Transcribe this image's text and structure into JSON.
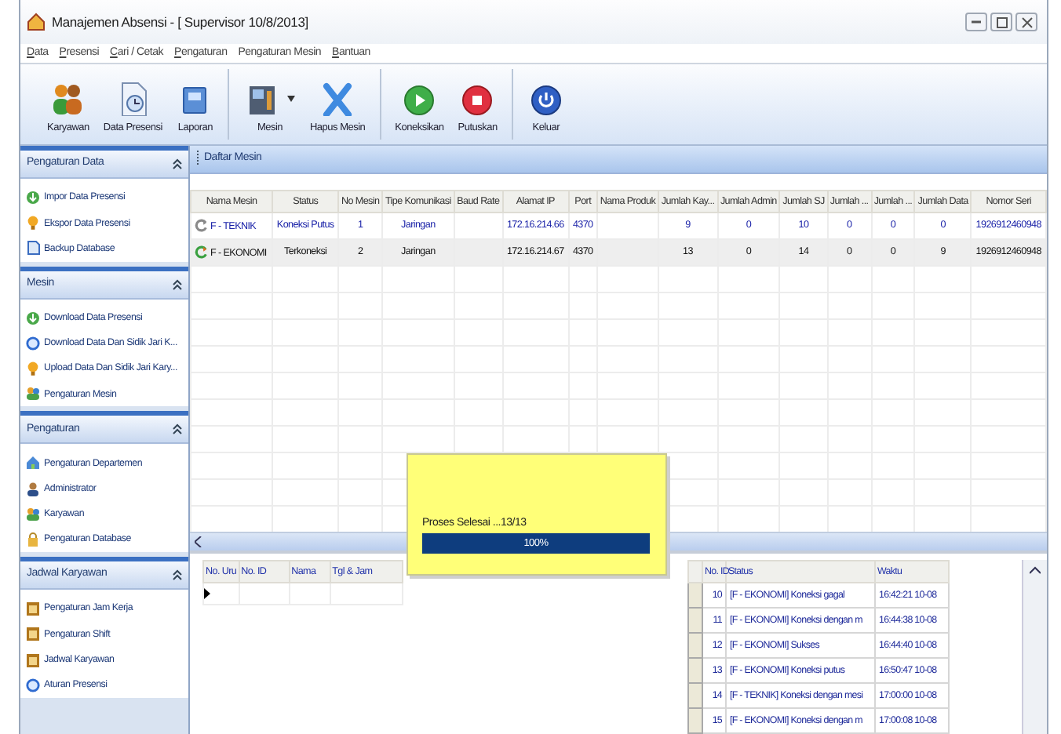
{
  "window": {
    "title": "Manajemen Absensi - [ Supervisor 10/8/2013]"
  },
  "menu": [
    {
      "label": "Data",
      "underline_first": true
    },
    {
      "label": "Presensi",
      "underline_first": true
    },
    {
      "label": "Cari / Cetak",
      "underline_first": true
    },
    {
      "label": "Pengaturan",
      "underline_first": true
    },
    {
      "label": "Pengaturan Mesin",
      "underline_first": false
    },
    {
      "label": "Bantuan",
      "underline_first": true
    }
  ],
  "toolbar": [
    [
      {
        "label": "Karyawan",
        "kind": "people",
        "dropdown": false
      },
      {
        "label": "Data Presensi",
        "kind": "document",
        "dropdown": false
      },
      {
        "label": "Laporan",
        "kind": "folder",
        "dropdown": false
      }
    ],
    [
      {
        "label": "Mesin",
        "kind": "machine",
        "dropdown": true
      },
      {
        "label": "Hapus Mesin",
        "kind": "xmark",
        "dropdown": false
      }
    ],
    [
      {
        "label": "Koneksikan",
        "kind": "play",
        "dropdown": false
      },
      {
        "label": "Putuskan",
        "kind": "stop",
        "dropdown": false
      }
    ],
    [
      {
        "label": "Keluar",
        "kind": "power",
        "dropdown": false
      }
    ]
  ],
  "sidebar": [
    {
      "title": "Pengaturan Data",
      "expanded": true,
      "items": [
        {
          "label": "Impor Data Presensi",
          "kind": "arrow"
        },
        {
          "label": "Ekspor Data Presensi",
          "kind": "bulb"
        },
        {
          "label": "Backup Database",
          "kind": "doc"
        }
      ]
    },
    {
      "title": "Mesin",
      "expanded": true,
      "items": [
        {
          "label": "Download Data Presensi",
          "kind": "arrow"
        },
        {
          "label": "Download Data Dan Sidik Jari K...",
          "kind": "ring"
        },
        {
          "label": "Upload Data Dan Sidik Jari Kary...",
          "kind": "bulb"
        },
        {
          "label": "Pengaturan Mesin",
          "kind": "people"
        }
      ]
    },
    {
      "title": "Pengaturan",
      "expanded": true,
      "items": [
        {
          "label": "Pengaturan Departemen",
          "kind": "house"
        },
        {
          "label": "Administrator",
          "kind": "person"
        },
        {
          "label": "Karyawan",
          "kind": "people"
        },
        {
          "label": "Pengaturan Database",
          "kind": "lock"
        }
      ]
    },
    {
      "title": "Jadwal Karyawan",
      "expanded": true,
      "items": [
        {
          "label": "Pengaturan Jam Kerja",
          "kind": "calendar"
        },
        {
          "label": "Pengaturan Shift",
          "kind": "calendar"
        },
        {
          "label": "Jadwal Karyawan",
          "kind": "calendar"
        },
        {
          "label": "Aturan Presensi",
          "kind": "ring"
        }
      ]
    }
  ],
  "panel": {
    "title": "Daftar Mesin"
  },
  "machines": {
    "columns": [
      "Nama Mesin",
      "Status",
      "No Mesin",
      "Tipe Komunikasi",
      "Baud Rate",
      "Alamat IP",
      "Port",
      "Nama Produk",
      "Jumlah Kay...",
      "Jumlah Admin",
      "Jumlah SJ",
      "Jumlah ...",
      "Jumlah ...",
      "Jumlah Data",
      "Nomor Seri"
    ],
    "rows": [
      {
        "selected": true,
        "connected": false,
        "cells": [
          "F - TEKNIK",
          "Koneksi Putus",
          "1",
          "Jaringan",
          null,
          "172.16.214.66",
          "4370",
          null,
          "9",
          "0",
          "10",
          "0",
          "0",
          "0",
          "1926912460948"
        ]
      },
      {
        "selected": false,
        "connected": true,
        "cells": [
          "F - EKONOMI",
          "Terkoneksi",
          "2",
          "Jaringan",
          null,
          "172.16.214.67",
          "4370",
          null,
          "13",
          "0",
          "14",
          "0",
          "0",
          "9",
          "1926912460948"
        ]
      }
    ]
  },
  "records": {
    "columns": [
      "No. Uru",
      "No. ID",
      "Nama",
      "Tgl & Jam"
    ]
  },
  "progress": {
    "message": "Proses Selesai ...13/13",
    "level": 1,
    "label": "100%"
  },
  "log": {
    "columns": [
      "No. ID",
      "Status",
      "Waktu"
    ],
    "rows": [
      [
        "10",
        "[F - EKONOMI] Koneksi gagal",
        "16:42:21 10-08"
      ],
      [
        "11",
        "[F - EKONOMI] Koneksi dengan m",
        "16:44:38 10-08"
      ],
      [
        "12",
        "[F - EKONOMI] Sukses",
        "16:44:40 10-08"
      ],
      [
        "13",
        "[F - EKONOMI] Koneksi putus",
        "16:50:47 10-08"
      ],
      [
        "14",
        "[F - TEKNIK] Koneksi dengan mesi",
        "17:00:00 10-08"
      ],
      [
        "15",
        "[F - EKONOMI] Koneksi dengan m",
        "17:00:08 10-08"
      ]
    ]
  }
}
